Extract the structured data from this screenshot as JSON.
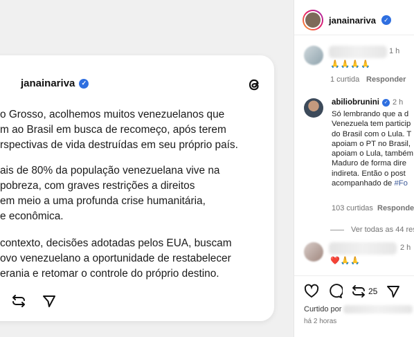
{
  "threads_post": {
    "username": "janainariva",
    "paragraphs": [
      [
        "o Grosso, acolhemos muitos venezuelanos que",
        "m ao Brasil em busca de recomeço, após terem",
        "rspectivas de vida destruídas em seu próprio país."
      ],
      [
        "ais de 80% da população venezuelana vive na",
        " pobreza, com graves restrições a direitos",
        " em meio a uma profunda crise humanitária,",
        "e econômica."
      ],
      [
        "contexto, decisões adotadas pelos EUA, buscam",
        "ovo venezuelano a oportunidade de restabelecer",
        "erania e retomar o controle do próprio destino."
      ]
    ]
  },
  "post": {
    "username": "janainariva",
    "comments": [
      {
        "time": "1 h",
        "likes": "1 curtida",
        "reply": "Responder"
      },
      {
        "username": "abiliobrunini",
        "time": "2 h",
        "lines": [
          "Só lembrando que a d",
          "Venezuela tem particip",
          "do Brasil com o Lula. T",
          "apoiam o PT no Brasil,",
          "apoiam o Lula, também",
          "Maduro de forma dire",
          "indireta. Então o post",
          "acompanhado de "
        ],
        "hashtag": "#Fo",
        "likes": "103 curtidas",
        "reply": "Responder"
      },
      {
        "time": "2 h"
      }
    ],
    "see_all": "Ver todas as 44 res",
    "repost_count": "25",
    "liked_by_prefix": "Curtido por",
    "time_ago": "há 2 horas"
  }
}
